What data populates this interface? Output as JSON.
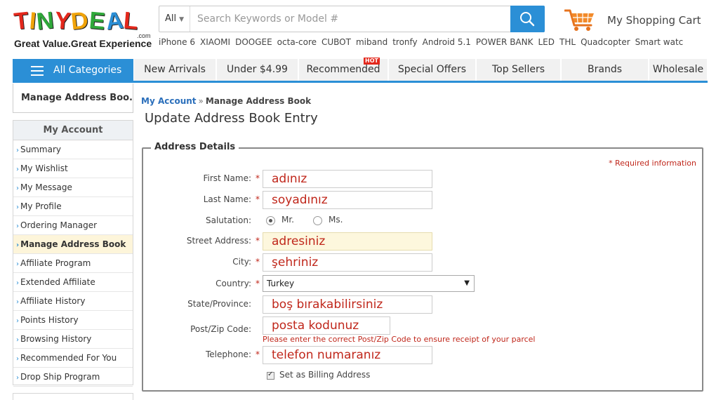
{
  "header": {
    "logo_letters": [
      "T",
      "I",
      "N",
      "Y",
      "D",
      "E",
      "A",
      "L"
    ],
    "logo_colors": [
      "#e3281c",
      "#f0a30a",
      "#2fa83a",
      "#e3281c",
      "#f0a30a",
      "#2fa83a",
      "#2b8fd6",
      "#e3281c"
    ],
    "logo_suffix": ".com",
    "logo_tagline": "Great Value.Great Experience",
    "search": {
      "category": "All",
      "placeholder": "Search Keywords or Model #"
    },
    "cart_label": "My Shopping Cart",
    "hot_searches": [
      "iPhone 6",
      "XIAOMI",
      "DOOGEE",
      "octa-core",
      "CUBOT",
      "miband",
      "tronfy",
      "Android 5.1",
      "POWER BANK",
      "LED",
      "THL",
      "Quadcopter",
      "Smart watc"
    ]
  },
  "nav": {
    "all_categories": "All Categories",
    "tabs": [
      {
        "label": "New Arrivals"
      },
      {
        "label": "Under $4.99"
      },
      {
        "label": "Recommended",
        "badge": "HOT"
      },
      {
        "label": "Special Offers"
      },
      {
        "label": "Top Sellers"
      },
      {
        "label": "Brands"
      },
      {
        "label": "Wholesale"
      }
    ]
  },
  "sidebar": {
    "current": "Manage Address Boo...",
    "title": "My Account",
    "items": [
      {
        "label": "Summary"
      },
      {
        "label": "My Wishlist"
      },
      {
        "label": "My Message"
      },
      {
        "label": "My Profile"
      },
      {
        "label": "Ordering Manager"
      },
      {
        "label": "Manage Address Book",
        "active": true
      },
      {
        "label": "Affiliate Program"
      },
      {
        "label": "Extended Affiliate"
      },
      {
        "label": "Affiliate History"
      },
      {
        "label": "Points History"
      },
      {
        "label": "Browsing History"
      },
      {
        "label": "Recommended For You"
      },
      {
        "label": "Drop Ship Program"
      }
    ]
  },
  "breadcrumb": {
    "root": "My Account",
    "separator": "»",
    "current": "Manage Address Book"
  },
  "page_title": "Update Address Book Entry",
  "form": {
    "legend": "Address Details",
    "required_note": "* Required information",
    "first_name": {
      "label": "First Name:",
      "value": "adınız"
    },
    "last_name": {
      "label": "Last Name:",
      "value": "soyadınız"
    },
    "salutation": {
      "label": "Salutation:",
      "options": [
        "Mr.",
        "Ms."
      ],
      "selected": "Mr."
    },
    "street": {
      "label": "Street Address:",
      "value": "adresiniz"
    },
    "city": {
      "label": "City:",
      "value": "şehriniz"
    },
    "country": {
      "label": "Country:",
      "value": "Turkey"
    },
    "state": {
      "label": "State/Province:",
      "value": "boş bırakabilirsiniz"
    },
    "postcode": {
      "label": "Post/Zip Code:",
      "value": "posta kodunuz",
      "hint": "Please enter the correct Post/Zip Code to ensure receipt of your parcel"
    },
    "telephone": {
      "label": "Telephone:",
      "value": "telefon numaranız"
    },
    "billing": {
      "label": "Set as Billing Address",
      "checked": true
    }
  },
  "colors": {
    "brand_blue": "#2b8fd6",
    "error_red": "#c0271b",
    "highlight": "#fdf5da"
  }
}
